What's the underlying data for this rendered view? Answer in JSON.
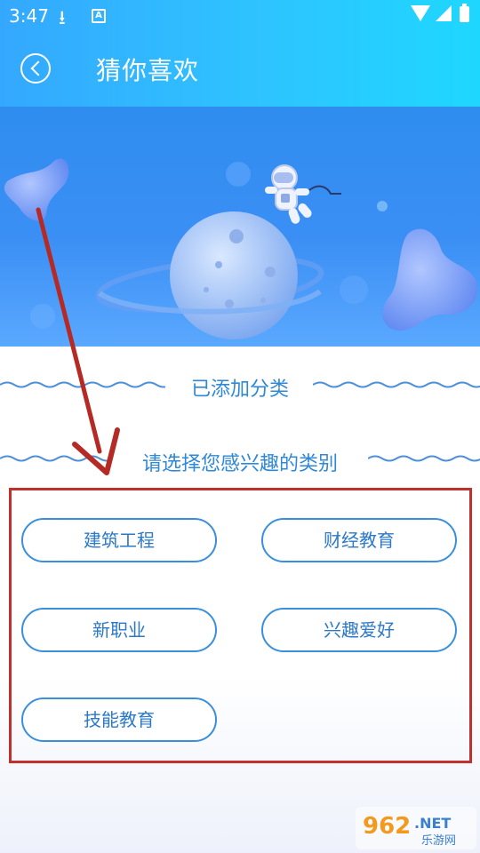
{
  "status_bar": {
    "time": "3:47",
    "download_icon": "download-icon",
    "app_icon_letter": "A"
  },
  "header": {
    "title": "猜你喜欢",
    "back_icon": "back-icon"
  },
  "sections": {
    "added_title": "已添加分类",
    "choose_title": "请选择您感兴趣的类别"
  },
  "categories": [
    {
      "label": "建筑工程"
    },
    {
      "label": "财经教育"
    },
    {
      "label": "新职业"
    },
    {
      "label": "兴趣爱好"
    },
    {
      "label": "技能教育"
    }
  ],
  "colors": {
    "header_gradient_start": "#34a8ff",
    "header_gradient_end": "#1ed7ff",
    "accent_text": "#2f88d6",
    "button_border": "#3a8fdc",
    "annotation_red": "#c0302c"
  },
  "watermark": {
    "brand": "962.NET",
    "sub": "乐游网"
  }
}
